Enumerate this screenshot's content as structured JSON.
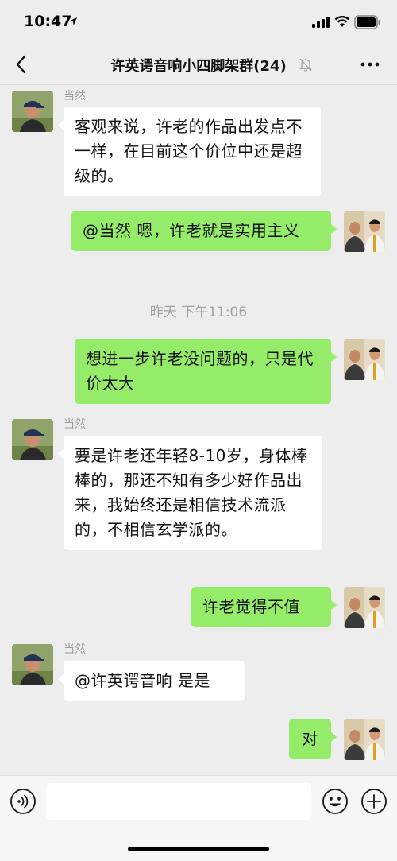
{
  "status_bar": {
    "time": "10:47"
  },
  "header": {
    "title": "许英谔音响小四脚架群(24)"
  },
  "messages": [
    {
      "side": "in",
      "sender": "当然",
      "text": "客观来说，许老的作品出发点不一样，在目前这个价位中还是超级的。"
    },
    {
      "side": "out",
      "text": "@当然 嗯，许老就是实用主义"
    },
    {
      "timestamp": "昨天 下午11:06"
    },
    {
      "side": "out",
      "text": "想进一步许老没问题的，只是代价太大"
    },
    {
      "side": "in",
      "sender": "当然",
      "text": "要是许老还年轻8-10岁，身体棒棒的，那还不知有多少好作品出来，我始终还是相信技术流派的，不相信玄学派的。"
    },
    {
      "side": "out",
      "text": "许老觉得不值"
    },
    {
      "side": "in",
      "sender": "当然",
      "text": "@许英谔音响 是是"
    },
    {
      "side": "out",
      "text": "对"
    }
  ],
  "input_bar": {
    "value": ""
  },
  "colors": {
    "outgoing_bubble": "#95ec69",
    "incoming_bubble": "#ffffff",
    "background": "#ededed"
  }
}
